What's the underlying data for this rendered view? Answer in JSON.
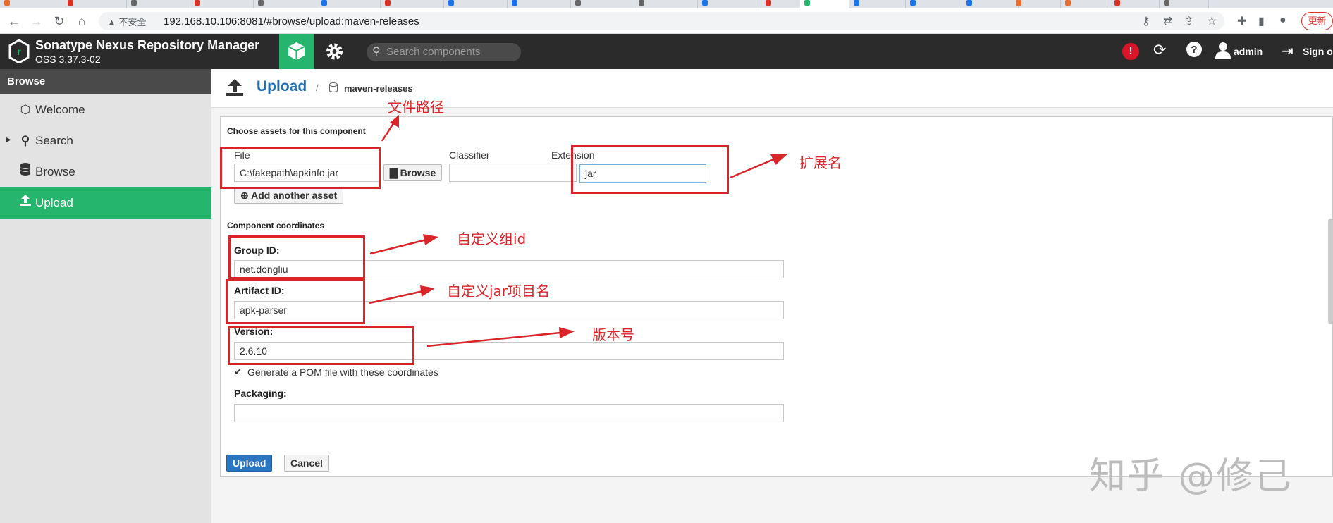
{
  "browser": {
    "security_label": "不安全",
    "url": "192.168.10.106:8081/#browse/upload:maven-releases",
    "update_label": "更新"
  },
  "app": {
    "title": "Sonatype Nexus Repository Manager",
    "version": "OSS 3.37.3-02",
    "search_placeholder": "Search components",
    "user": "admin",
    "signout": "Sign out"
  },
  "sidebar": {
    "header": "Browse",
    "items": [
      {
        "label": "Welcome",
        "icon": "hexagon-icon"
      },
      {
        "label": "Search",
        "icon": "search-icon"
      },
      {
        "label": "Browse",
        "icon": "database-icon"
      },
      {
        "label": "Upload",
        "icon": "upload-icon"
      }
    ]
  },
  "page": {
    "title": "Upload",
    "separator": "/",
    "repository": "maven-releases"
  },
  "form": {
    "assets_heading": "Choose assets for this component",
    "file_label": "File",
    "file_value": "C:\\fakepath\\apkinfo.jar",
    "browse_label": "Browse",
    "classifier_label": "Classifier",
    "classifier_value": "",
    "extension_label": "Extension",
    "extension_value": "jar",
    "add_asset_label": "Add another asset",
    "coords_heading": "Component coordinates",
    "group_label": "Group ID:",
    "group_value": "net.dongliu",
    "artifact_label": "Artifact ID:",
    "artifact_value": "apk-parser",
    "version_label": "Version:",
    "version_value": "2.6.10",
    "generate_pom_label": "Generate a POM file with these coordinates",
    "packaging_label": "Packaging:",
    "packaging_value": "",
    "upload_label": "Upload",
    "cancel_label": "Cancel"
  },
  "annotations": {
    "file_path": "文件路径",
    "extension": "扩展名",
    "group": "自定义组id",
    "artifact": "自定义jar项目名",
    "version": "版本号",
    "watermark": "知乎 @修己"
  },
  "colors": {
    "accent_green": "#26b56c",
    "header_dark": "#2b2b2b",
    "title_blue": "#1f6fb4",
    "annotation_red": "#d9252a"
  }
}
